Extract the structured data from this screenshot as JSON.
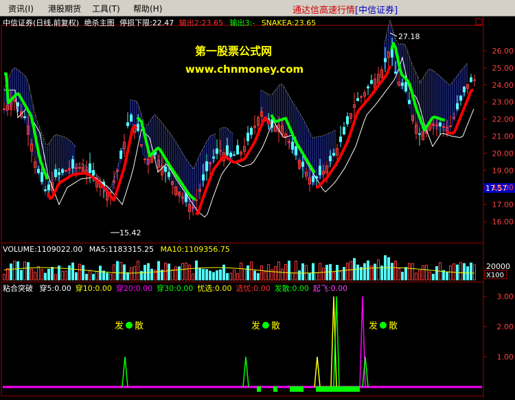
{
  "menu": {
    "items": [
      "资讯(I)",
      "港股期货",
      "工具(T)",
      "帮助(H)"
    ],
    "title_main": "通达信高速行情",
    "title_broker": "[中信证券]"
  },
  "main_panel": {
    "stock": "中信证券(日线,前复权)",
    "indicator": "绝杀主图",
    "stop_loss": "停损下限:22.47",
    "output2": "输出2:23.65",
    "output3": "输出3:-",
    "snakea": "SNAKEA:23.65",
    "watermark_title": "第一股票公式网",
    "watermark_url": "www.chnmoney.com",
    "high_label": "27.18",
    "low_label": "15.42",
    "price_marker": "17.57",
    "y_ticks": [
      "26.00",
      "25.00",
      "24.00",
      "23.00",
      "22.00",
      "21.00",
      "20.00",
      "19.00",
      "18.00",
      "17.00",
      "16.00"
    ]
  },
  "volume_panel": {
    "volume": "VOLUME:1109022.00",
    "ma5": "MA5:1183315.25",
    "ma10": "MA10:1109356.75",
    "y_tick": "20000",
    "unit": "X100"
  },
  "signal_panel": {
    "name": "粘合突破",
    "items": [
      {
        "text": "穿5:0.00",
        "color": "#ffffff"
      },
      {
        "text": "穿10:0.00",
        "color": "#ffff00"
      },
      {
        "text": "穿20:0.00",
        "color": "#ff00ff"
      },
      {
        "text": "穿30:0.00",
        "color": "#00ff00"
      },
      {
        "text": "忧选:0.00",
        "color": "#ffff00"
      },
      {
        "text": "选忧:0.00",
        "color": "#ff3030"
      },
      {
        "text": "发散:0.00",
        "color": "#00ff00"
      },
      {
        "text": "起飞:0.00",
        "color": "#ff40ff"
      }
    ],
    "fa_label": "发",
    "san_label": "散",
    "y_ticks": [
      "3.00",
      "2.00",
      "1.00"
    ]
  },
  "colors": {
    "up": "#ff3c3c",
    "down": "#54fcfc",
    "axis": "#a00000",
    "bull_line": "#ff0000",
    "bear_line": "#00ff00",
    "cloud": "#3040c0",
    "white_line": "#ffffff",
    "yellow": "#ffff00",
    "magenta": "#ff00ff"
  }
}
